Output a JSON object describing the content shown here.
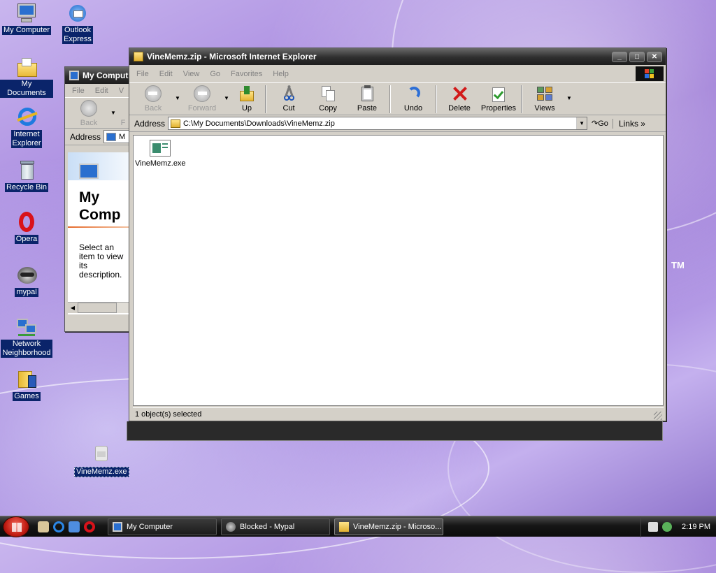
{
  "desktop": {
    "icons": [
      {
        "label_lines": [
          "My Computer"
        ],
        "icon": "my-computer-icon"
      },
      {
        "label_lines": [
          "Outlook",
          "Express"
        ],
        "icon": "outlook-express-icon"
      },
      {
        "label_lines": [
          "My Documents"
        ],
        "icon": "my-documents-icon"
      },
      {
        "label_lines": [
          "Internet",
          "Explorer"
        ],
        "icon": "internet-explorer-icon"
      },
      {
        "label_lines": [
          "Recycle Bin"
        ],
        "icon": "recycle-bin-icon"
      },
      {
        "label_lines": [
          "Opera"
        ],
        "icon": "opera-icon"
      },
      {
        "label_lines": [
          "mypal"
        ],
        "icon": "mypal-icon"
      },
      {
        "label_lines": [
          "Network",
          "Neighborhood"
        ],
        "icon": "network-neighborhood-icon"
      },
      {
        "label_lines": [
          "Games"
        ],
        "icon": "games-folder-icon"
      },
      {
        "label_lines": [
          "VineMemz.exe"
        ],
        "icon": "vinememz-exe-icon"
      }
    ],
    "trademark": "TM"
  },
  "back_window": {
    "title": "My Comput",
    "menu": [
      "File",
      "Edit",
      "V"
    ],
    "back_label": "Back",
    "forward_fragment": "F",
    "address_label": "Address",
    "address_fragment": "M",
    "panel_title_line1": "My",
    "panel_title_line2": "Comp",
    "panel_text_lines": [
      "Select an",
      "item to view",
      "its",
      "description."
    ]
  },
  "front_window": {
    "title": "VineMemz.zip - Microsoft Internet Explorer",
    "menu": [
      "File",
      "Edit",
      "View",
      "Go",
      "Favorites",
      "Help"
    ],
    "toolbar": {
      "back": "Back",
      "forward": "Forward",
      "up": "Up",
      "cut": "Cut",
      "copy": "Copy",
      "paste": "Paste",
      "undo": "Undo",
      "delete": "Delete",
      "properties": "Properties",
      "views": "Views"
    },
    "address_label": "Address",
    "address_value": "C:\\My Documents\\Downloads\\VineMemz.zip",
    "go_label": "Go",
    "links_label": "Links",
    "files": [
      {
        "name": "VineMemz.exe",
        "icon": "exe-file-icon"
      }
    ],
    "status": "1 object(s) selected"
  },
  "taskbar": {
    "tasks": [
      {
        "label": "My Computer",
        "icon": "my-computer-icon"
      },
      {
        "label": "Blocked - Mypal",
        "icon": "mypal-icon"
      },
      {
        "label": "VineMemz.zip - Microso...",
        "icon": "zip-folder-icon"
      }
    ],
    "clock": "2:19 PM"
  }
}
